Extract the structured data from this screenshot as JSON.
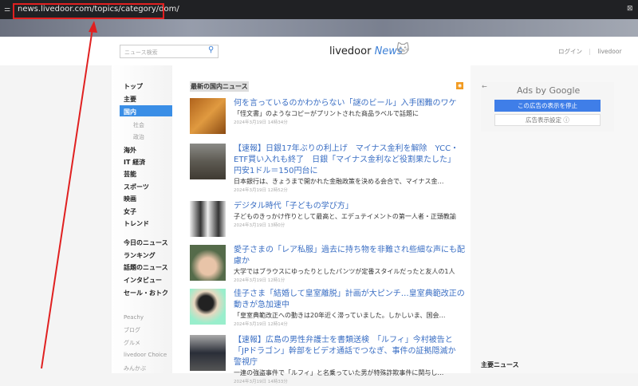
{
  "browser": {
    "url": "news.livedoor.com/topics/category/dom/"
  },
  "header": {
    "search_placeholder": "ニュース検索",
    "logo_main": "livedoor",
    "logo_accent": "News",
    "login": "ログイン",
    "divider": "|",
    "livedoor_link": "livedoor"
  },
  "nav": {
    "items": [
      "トップ",
      "主要",
      "国内",
      "社会",
      "政治",
      "海外",
      "IT 経済",
      "芸能",
      "スポーツ",
      "映画",
      "女子",
      "トレンド",
      "今日のニュース",
      "ランキング",
      "話題のニュース",
      "インタビュー",
      "セール・おトク",
      "Peachy",
      "ブログ",
      "グルメ",
      "livedoor Choice",
      "みんかぶ"
    ]
  },
  "main": {
    "section_title": "最新の国内ニュース",
    "articles": [
      {
        "title": "何を言っているのかわからない「謎のビール」入手困難のワケ",
        "desc": "「怪文書」のようなコピーがプリントされた商品ラベルで話題に",
        "time": "2024年3月19日 14時34分"
      },
      {
        "title": "【速報】日銀17年ぶりの利上げ　マイナス金利を解除　YCC・ETF買い入れも終了　日銀「マイナス金利など役割果たした」 円安1ドル＝150円台に",
        "desc": "日本銀行は、きょうまで開かれた金融政策を決める会合で、マイナス金…",
        "time": "2024年3月19日 12時52分"
      },
      {
        "title": "デジタル時代「子どもの学び方」",
        "desc": "子どものきっかけ作りとして最高と、エデュテイメントの第一人者・正頭教諭",
        "time": "2024年3月19日 13時0分"
      },
      {
        "title": "愛子さまの「レア私服」過去に持ち物を非難され些細な声にも配慮か",
        "desc": "大学ではブラウスにゆったりとしたパンツが定番スタイルだったと友人の1人",
        "time": "2024年3月19日 12時1分"
      },
      {
        "title": "佳子さま「結婚して皇室離脱」計画が大ピンチ…皇室典範改正の動きが急加速中",
        "desc": "「皇室典範改正への動きは20年近く滞っていました。しかしいま、国会…",
        "time": "2024年3月19日 12時14分"
      },
      {
        "title": "【速報】広島の男性弁護士を書類送検　「ルフィ」今村被告と「JPドラゴン」幹部をビデオ通話でつなぎ、事件の証拠隠滅か　警視庁",
        "desc": "一連の強盗事件で「ルフィ」と名乗っていた男が特殊詐欺事件に関与し…",
        "time": "2024年3月19日 14時33分"
      }
    ]
  },
  "ad": {
    "back": "←",
    "ads_by": "Ads by Google",
    "stop": "この広告の表示を停止",
    "settings": "広告表示設定 ⓘ"
  },
  "side": {
    "major_news": "主要ニュース"
  },
  "colors": {
    "accent": "#3a8ee6",
    "link": "#3b6fc4",
    "annotation": "#e02020"
  }
}
